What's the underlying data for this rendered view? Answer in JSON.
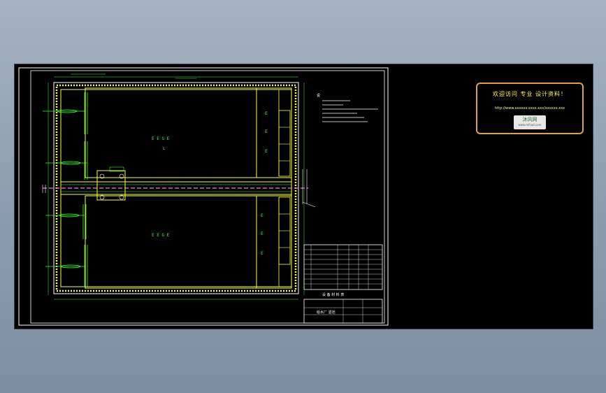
{
  "ad": {
    "headline": "欢迎访问 专业 设计资料！",
    "url": "http://www.xxxxxx.xxxx.xxx/xxxxxx.xxx",
    "logo_text": "沐风网",
    "logo_sub": "www.mfcad.com"
  },
  "drawing": {
    "tank_labels": [
      "E  E  G  E",
      "L",
      "E  E  G  E"
    ],
    "channel_labels": [
      "E",
      "E",
      "E",
      "E",
      "E",
      "E"
    ],
    "notes_heading": "说",
    "table_title": "设 备 材 料 表",
    "title_block": "给水厂 滤池"
  },
  "colors": {
    "background_gradient_top": "#a6b2c2",
    "viewport": "#000000",
    "outline": "#ffffff",
    "structure": "#ffff33",
    "dimension": "#33ff33",
    "pipe": "#ff66ff",
    "accent": "#e0a050"
  }
}
